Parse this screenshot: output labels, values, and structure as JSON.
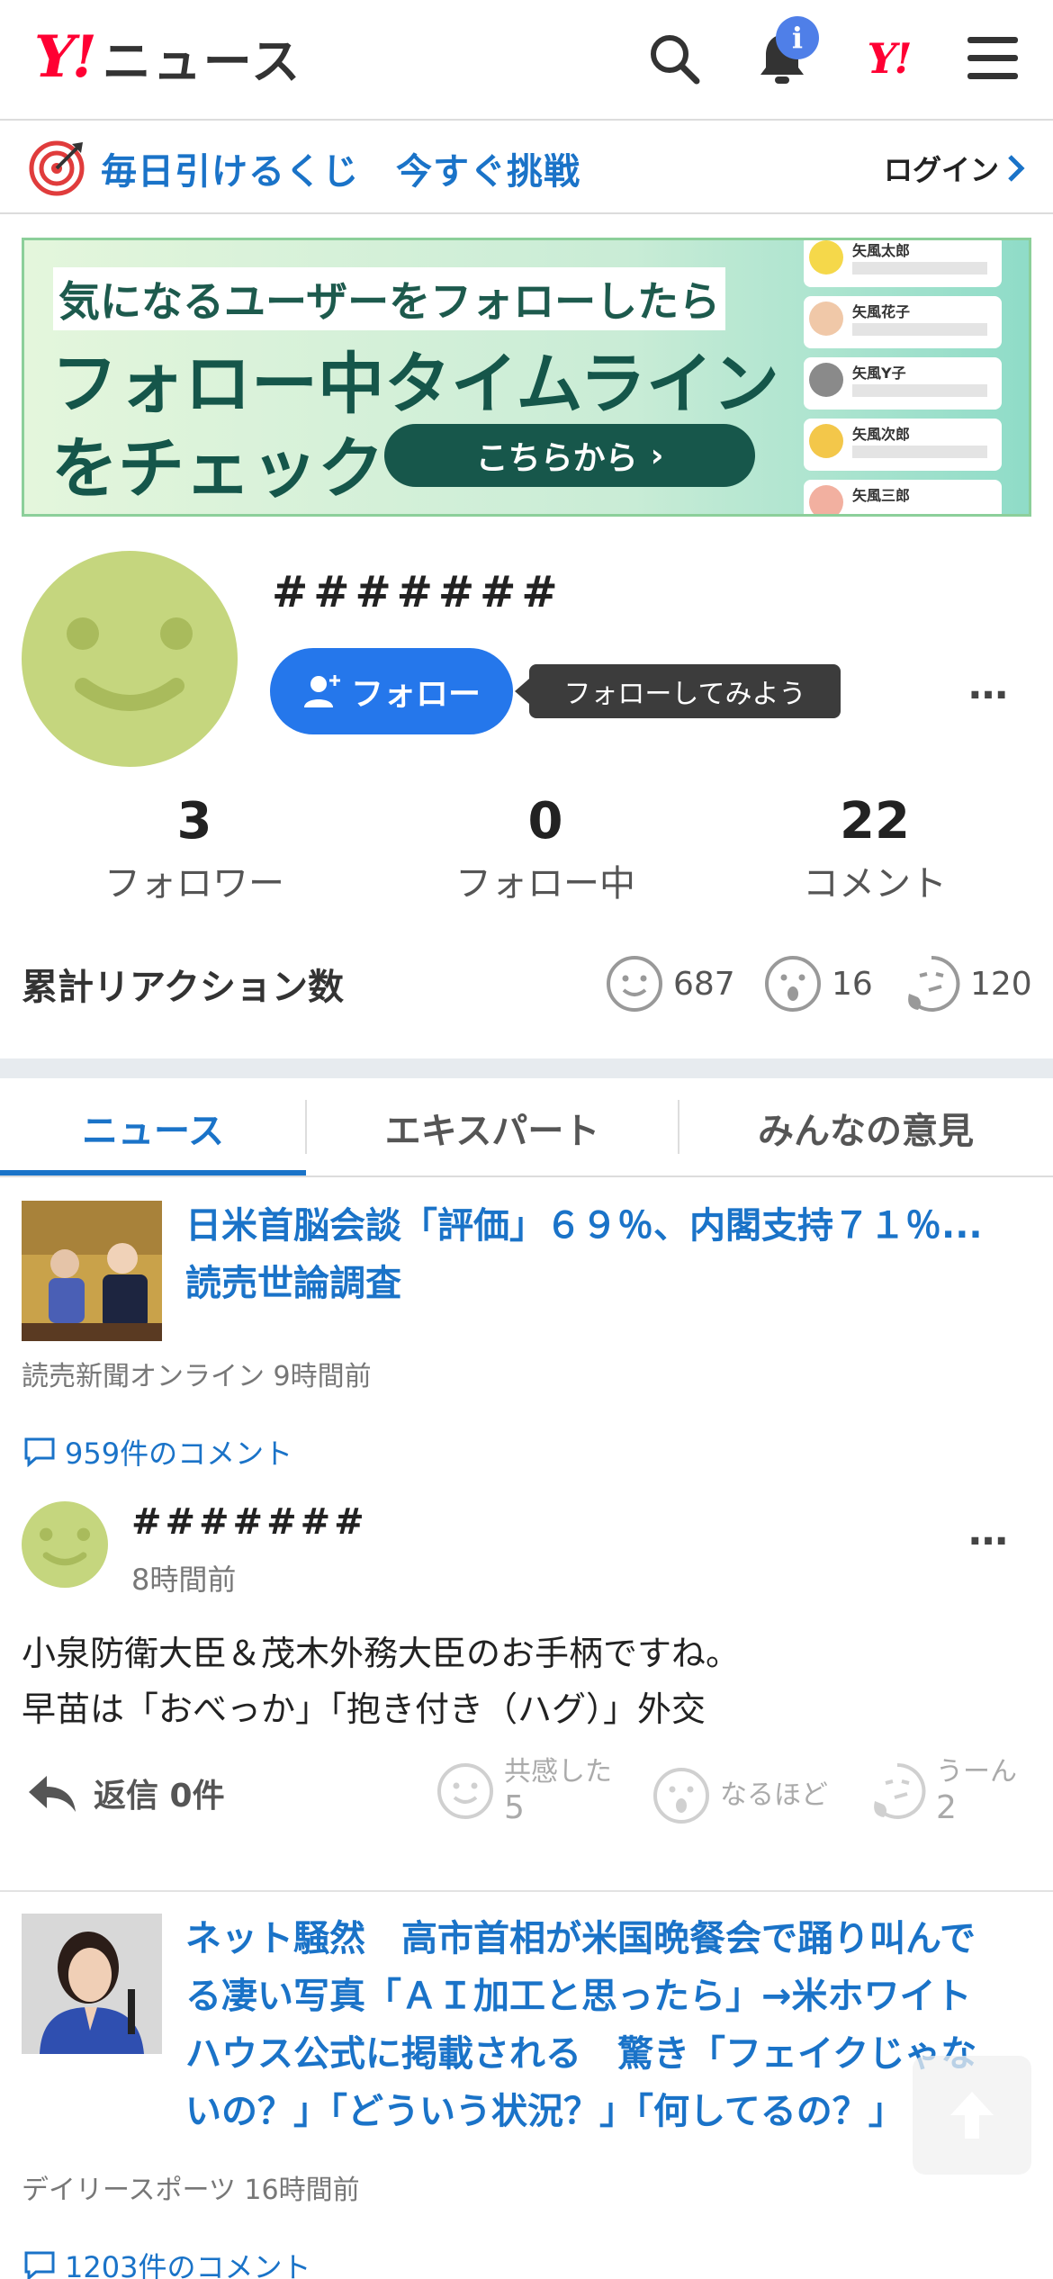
{
  "header": {
    "logo_mark": "Y!",
    "logo_text": "ニュース",
    "notification_count": "i",
    "yahoo_mark": "Y!"
  },
  "lottery": {
    "text": "毎日引けるくじ　今すぐ挑戦",
    "login": "ログイン"
  },
  "banner": {
    "line1": "気になるユーザーをフォローしたら",
    "line2": "フォロー中タイムライン",
    "line3": "をチェック",
    "button": "こちらから",
    "users": [
      "矢風太郎",
      "矢風花子",
      "矢風Y子",
      "矢風次郎",
      "矢風三郎"
    ]
  },
  "profile": {
    "username": "#######",
    "follow_button": "フォロー",
    "tooltip": "フォローしてみよう",
    "more": "…",
    "stats": [
      {
        "num": "3",
        "label": "フォロワー"
      },
      {
        "num": "0",
        "label": "フォロー中"
      },
      {
        "num": "22",
        "label": "コメント"
      }
    ],
    "reactions_title": "累計リアクション数",
    "reactions": [
      {
        "icon": "smile-icon",
        "count": "687"
      },
      {
        "icon": "surprised-icon",
        "count": "16"
      },
      {
        "icon": "thinking-icon",
        "count": "120"
      }
    ]
  },
  "tabs": [
    {
      "label": "ニュース",
      "active": true
    },
    {
      "label": "エキスパート",
      "active": false
    },
    {
      "label": "みんなの意見",
      "active": false
    }
  ],
  "articles": [
    {
      "title_line1": "日米首脳会談「評価」６９％、内閣支持７１％...",
      "title_line2": "読売世論調査",
      "meta": "読売新聞オンライン 9時間前",
      "comments": "959件のコメント"
    },
    {
      "title_lines": [
        "ネット騒然　高市首相が米国晩餐会で踊り叫んで",
        "る凄い写真「ＡＩ加工と思ったら」→米ホワイト",
        "ハウス公式に掲載される　驚き「フェイクじゃな",
        "いの？」「どういう状況？」「何してるの？」"
      ],
      "meta": "デイリースポーツ 16時間前",
      "comments": "1203件のコメント"
    }
  ],
  "comment": {
    "user": "#######",
    "time": "8時間前",
    "body_line1": "小泉防衛大臣＆茂木外務大臣のお手柄ですね。",
    "body_line2": "早苗は「おべっか」「抱き付き（ハグ）」外交",
    "reply_label": "返信 0件",
    "reactions": [
      {
        "label": "共感した",
        "count": "5"
      },
      {
        "label": "なるほど",
        "count": ""
      },
      {
        "label": "うーん",
        "count": "2"
      }
    ]
  },
  "colors": {
    "accent_blue": "#1a73c8",
    "follow_blue": "#2577eb",
    "yahoo_red": "#ff0033",
    "avatar_green": "#c5d67e"
  }
}
